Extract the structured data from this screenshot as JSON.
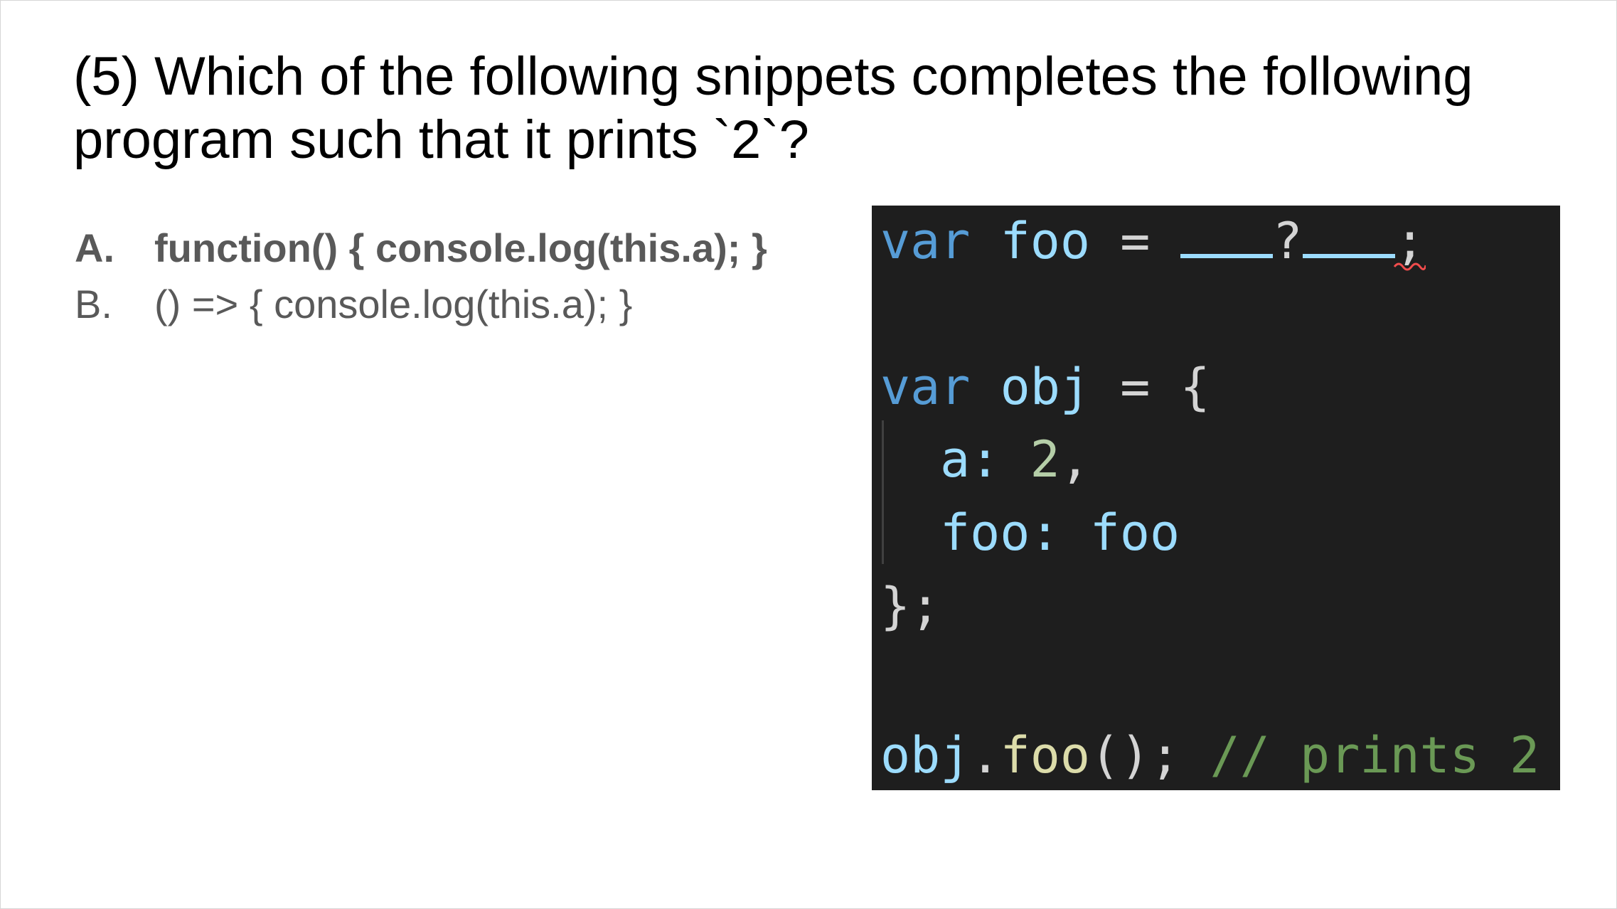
{
  "slide": {
    "title": "(5) Which of the following snippets completes the following program such that it prints `2`?",
    "options": [
      {
        "letter": "A.",
        "text": "function() { console.log(this.a); }"
      },
      {
        "letter": "B.",
        "text": "() => { console.log(this.a); }"
      }
    ]
  },
  "code": {
    "line1": {
      "kw": "var",
      "id": "foo",
      "eq": "=",
      "q": "?",
      "semi": ";"
    },
    "line2": {
      "kw": "var",
      "id": "obj",
      "rest": "= {"
    },
    "line3": {
      "key": "a:",
      "num": "2",
      "comma": ","
    },
    "line4": {
      "key": "foo:",
      "val": "foo"
    },
    "line5": {
      "text": "};"
    },
    "line6": {
      "obj": "obj",
      "dot": ".",
      "fn": "foo",
      "call": "();",
      "comment": "// prints 2"
    }
  },
  "colors": {
    "code_bg": "#1e1e1e",
    "keyword": "#569cd6",
    "identifier": "#9cdcfe",
    "number": "#b5cea8",
    "comment": "#6a9955",
    "squiggle": "#f14c4c"
  },
  "icons": {
    "error_squiggle": "error-squiggle-icon"
  }
}
